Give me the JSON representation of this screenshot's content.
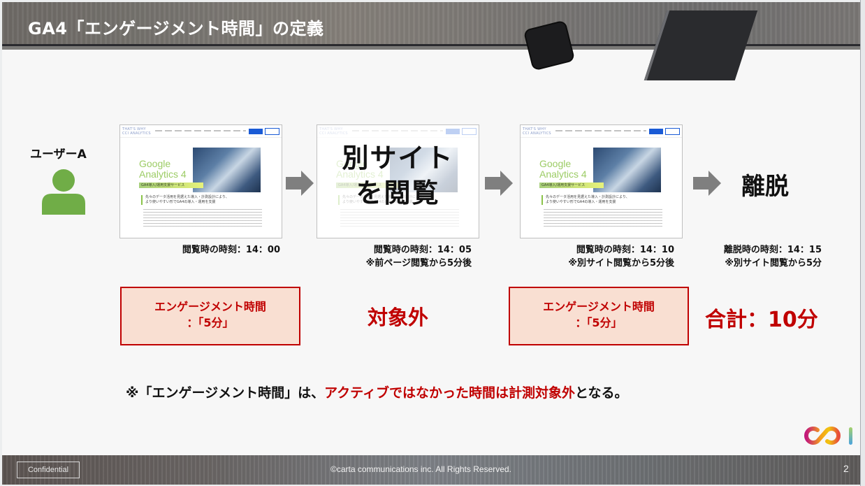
{
  "header": {
    "title": "GA4「エンゲージメント時間」の定義"
  },
  "user": {
    "label": "ユーザーA",
    "icon": "person-icon"
  },
  "steps": [
    {
      "type": "page",
      "thumbnail": {
        "logo": "THAT'S WHY\nCCI ANALYTICS",
        "title_line1": "Google",
        "title_line2": "Analytics 4",
        "band": "GA4導入/運用支援サービス",
        "lead_line1": "先々のデータ活用を見据えた導入・計測設計により、",
        "lead_line2": "より使いやすい形でGA4の導入・運用を支援"
      },
      "caption_line1": "閲覧時の時刻：14：00",
      "caption_line2": ""
    },
    {
      "type": "other-site",
      "overlay_line1": "別サイト",
      "overlay_line2": "を閲覧",
      "caption_line1": "閲覧時の時刻：14：05",
      "caption_line2": "※前ページ閲覧から5分後"
    },
    {
      "type": "page",
      "caption_line1": "閲覧時の時刻：14：10",
      "caption_line2": "※別サイト閲覧から5分後"
    },
    {
      "type": "exit",
      "label": "離脱",
      "caption_line1": "離脱時の時刻：14：15",
      "caption_line2": "※別サイト閲覧から5分"
    }
  ],
  "results": {
    "box1_line1": "エンゲージメント時間",
    "box1_line2": "：「5分」",
    "middle": "対象外",
    "box2_line1": "エンゲージメント時間",
    "box2_line2": "：「5分」",
    "total": "合計：10分"
  },
  "note": {
    "prefix": "※「エンゲージメント時間」は、",
    "highlight": "アクティブではなかった時間は計測対象外",
    "suffix": "となる。"
  },
  "footer": {
    "confidential": "Confidential",
    "copyright": "©carta communications inc. All Rights Reserved.",
    "page_number": "2"
  },
  "colors": {
    "accent_red": "#c00000",
    "box_fill": "#f9dfd2",
    "user_green": "#70ad47",
    "arrow_gray": "#7f7f7f"
  }
}
